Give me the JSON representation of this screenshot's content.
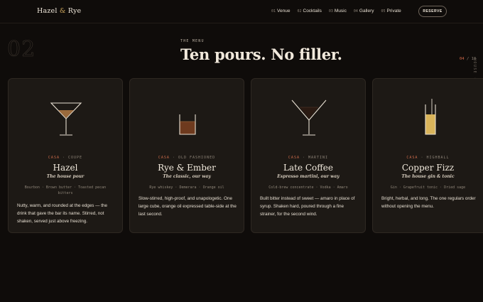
{
  "brand": {
    "name_a": "Hazel",
    "amp": "&",
    "name_b": "Rye"
  },
  "nav": [
    {
      "num": "01",
      "label": "Venue"
    },
    {
      "num": "02",
      "label": "Cocktails"
    },
    {
      "num": "03",
      "label": "Music"
    },
    {
      "num": "04",
      "label": "Gallery"
    },
    {
      "num": "05",
      "label": "Private"
    }
  ],
  "reserve_label": "RESERVE",
  "section": {
    "number": "02",
    "eyebrow": "THE MENU",
    "title": "Ten pours. No filler.",
    "counter_current": "04",
    "counter_sep": "/",
    "counter_total": "10",
    "side_text": "HOUSE · WED — SUN · 7:00 PM — 2:00 AM"
  },
  "cards": [
    {
      "origin": "CASA",
      "glass_type": "COUPE",
      "name": "Hazel",
      "subtitle": "The house pour",
      "ingredients": "Bourbon · Brown butter · Toasted pecan bitters",
      "description": "Nutty, warm, and rounded at the edges — the drink that gave the bar its name. Stirred, not shaken, served just above freezing.",
      "glass_icon": "coupe-glass-icon",
      "liquid_color": "#9a6a3c"
    },
    {
      "origin": "CASA",
      "glass_type": "OLD FASHIONED",
      "name": "Rye & Ember",
      "subtitle": "The classic, our way",
      "ingredients": "Rye whiskey · Demerara · Orange oil",
      "description": "Slow-stirred, high-proof, and unapologetic. One large cube, orange oil expressed table-side at the last second.",
      "glass_icon": "rocks-glass-icon",
      "liquid_color": "#6e3a1e"
    },
    {
      "origin": "CASA",
      "glass_type": "MARTINI",
      "name": "Late Coffee",
      "subtitle": "Espresso martini, our way",
      "ingredients": "Cold-brew concentrate · Vodka · Amaro",
      "description": "Built bitter instead of sweet — amaro in place of syrup. Shaken hard, poured through a fine strainer, for the second wind.",
      "glass_icon": "martini-glass-icon",
      "liquid_color": "#2a1a12"
    },
    {
      "origin": "CASA",
      "glass_type": "HIGHBALL",
      "name": "Copper Fizz",
      "subtitle": "The house gin & tonic",
      "ingredients": "Gin · Grapefruit tonic · Dried sage",
      "description": "Bright, herbal, and long. The one regulars order without opening the menu.",
      "glass_icon": "highball-glass-icon",
      "liquid_color": "#d9b45a"
    }
  ],
  "colors": {
    "background": "#0f0c0a",
    "card": "#1d1915",
    "accent": "#c96a4a",
    "gold": "#c9a35a"
  }
}
